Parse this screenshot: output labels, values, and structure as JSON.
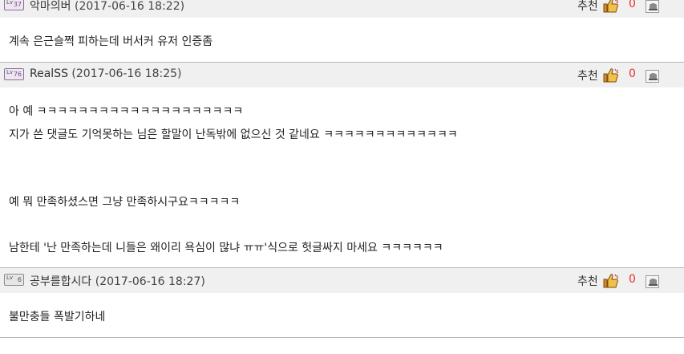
{
  "comments": [
    {
      "author": "악마의버",
      "date": "(2017-06-16 18:22)",
      "recommend_label": "추천",
      "recommend_count": "0",
      "body": [
        "계속 은근슬쩍 피하는데 버서커 유저 인증좀"
      ]
    },
    {
      "author": "RealSS",
      "date": "(2017-06-16 18:25)",
      "recommend_label": "추천",
      "recommend_count": "0",
      "body": [
        "아 예 ㅋㅋㅋㅋㅋㅋㅋㅋㅋㅋㅋㅋㅋㅋㅋㅋㅋㅋㅋㅋ",
        "지가 쓴 댓글도 기억못하는 님은 할말이 난독밖에 없으신 것 같네요 ㅋㅋㅋㅋㅋㅋㅋㅋㅋㅋㅋㅋㅋ",
        "예 뭐 만족하셨스면 그냥 만족하시구요ㅋㅋㅋㅋㅋ",
        "남한테 '난 만족하는데 니들은 왜이리 욕심이 많냐 ㅠㅠ'식으로 헛글싸지 마세요 ㅋㅋㅋㅋㅋㅋ"
      ]
    },
    {
      "author": "공부를합시다",
      "date": "(2017-06-16 18:27)",
      "recommend_label": "추천",
      "recommend_count": "0",
      "body": [
        "불만충들 폭발기하네"
      ]
    }
  ],
  "icons": {
    "level_icon_1": "level-badge-icon",
    "level_icon_2": "level-badge-icon",
    "level_icon_3": "level-badge-icon",
    "recommend_icon": "thumbs-up-icon",
    "report_icon": "report-icon"
  },
  "colors": {
    "header_bg": "#f0f0f0",
    "recommend_count": "#e53030",
    "separator": "#b5b5b5"
  }
}
